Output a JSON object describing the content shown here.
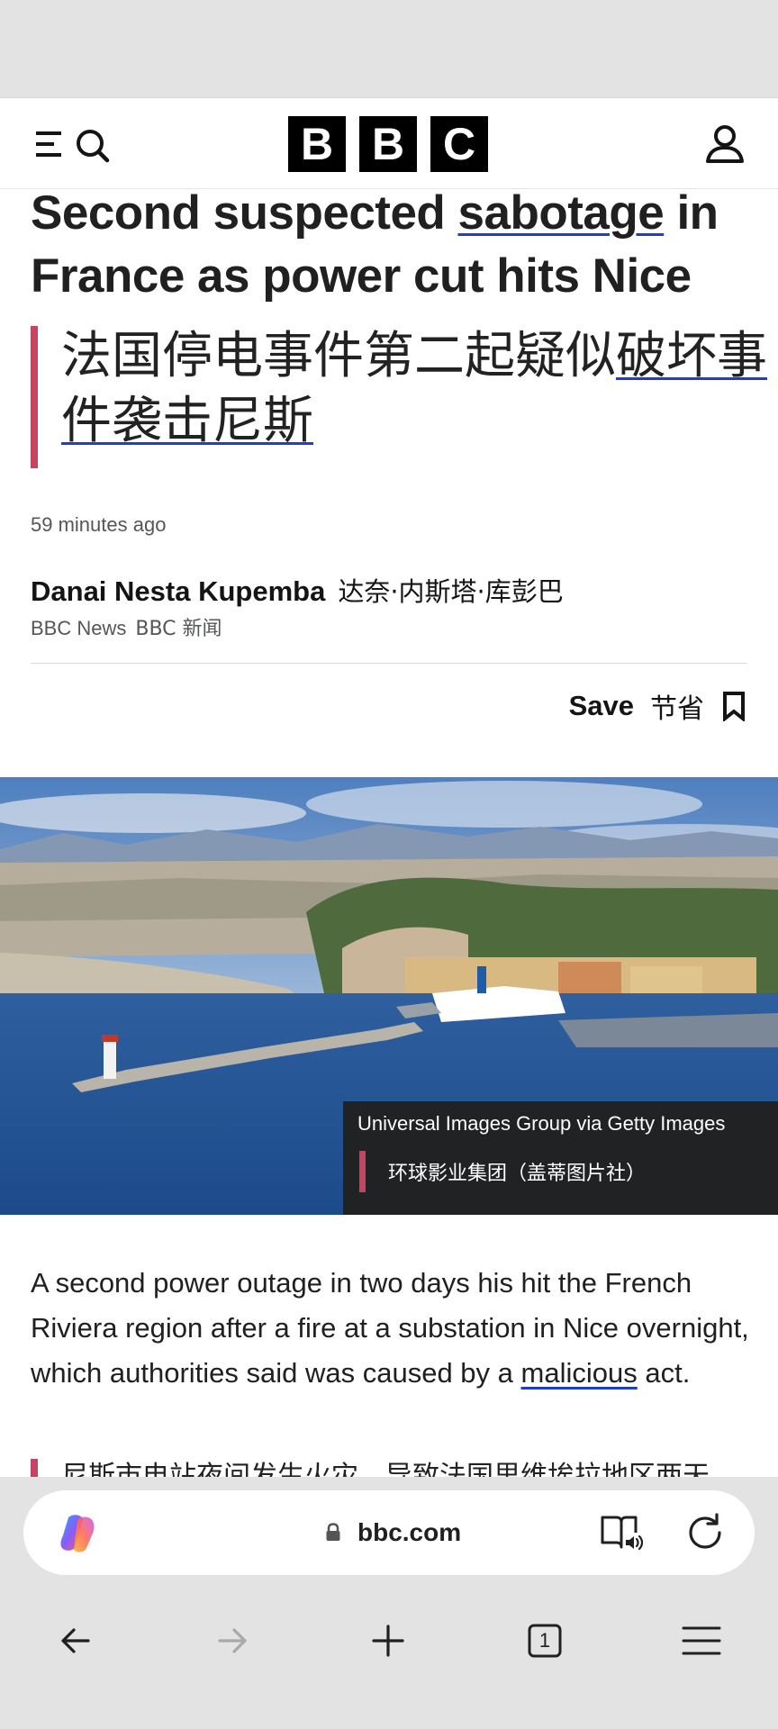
{
  "header": {
    "logo_letters": [
      "B",
      "B",
      "C"
    ],
    "icons": [
      "menu-icon",
      "search-icon",
      "account-icon"
    ]
  },
  "article": {
    "headline_before": "Second suspected ",
    "headline_link": "sabotage",
    "headline_after": " in France as power cut hits Nice",
    "zh_headline_before": "法国停电事件第二起疑似",
    "zh_headline_link": "破坏事件袭击尼斯",
    "timestamp": "59 minutes ago",
    "author_name": "Danai Nesta Kupemba",
    "author_name_zh": "达奈·内斯塔·库彭巴",
    "org": "BBC News",
    "org_zh": "BBC 新闻",
    "save_label": "Save",
    "save_label_zh": "节省",
    "image_caption": "Universal Images Group via Getty Images",
    "image_caption_zh": "环球影业集团（盖蒂图片社）",
    "body_before": "A second power outage in two days his hit the French Riviera region after a fire at a substation in Nice overnight, which authorities said was caused by a ",
    "body_link": "malicious",
    "body_after": " act.",
    "next_paragraph_zh": "尼斯市电站夜间发生火灾，导致法国里维埃拉地区两天"
  },
  "browser": {
    "url": "bbc.com",
    "tab_count": "1",
    "icons": [
      "copilot-icon",
      "lock-icon",
      "read-aloud-icon",
      "reload-icon",
      "back-icon",
      "forward-icon",
      "new-tab-icon",
      "tabs-icon",
      "menu-icon"
    ],
    "forward_enabled": false
  },
  "colors": {
    "accent_bar": "#c44462",
    "link_underline": "#1f3fc9",
    "chrome_bg": "#e3e3e3",
    "caption_bg": "#202224"
  }
}
